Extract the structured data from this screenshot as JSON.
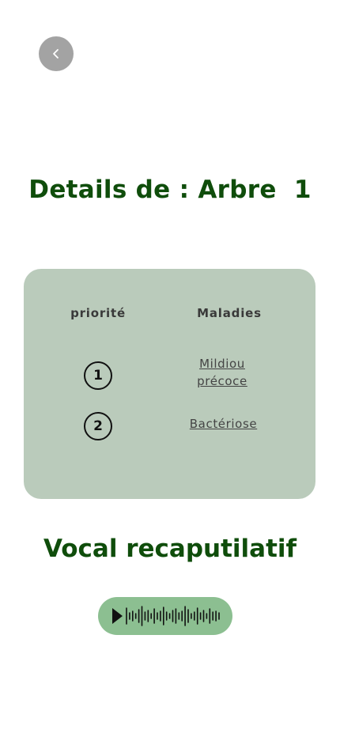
{
  "header": {
    "back_icon": "chevron-left-icon",
    "back_button_color": "#a3a3a3"
  },
  "title": {
    "prefix": "Details de : ",
    "tree_name": "Arbre  1",
    "color": "#0f4d0b"
  },
  "card": {
    "background": "#bacbbb",
    "headers": {
      "priority": "priorité",
      "maladies": "Maladies"
    },
    "rows": [
      {
        "priority": "1",
        "disease": "Mildiou précoce"
      },
      {
        "priority": "2",
        "disease": "Bactériose"
      }
    ]
  },
  "vocal": {
    "title": "Vocal recaputilatif",
    "play_icon": "play-icon",
    "waveform_icon": "waveform-icon",
    "pill_color": "#8cbf91"
  }
}
